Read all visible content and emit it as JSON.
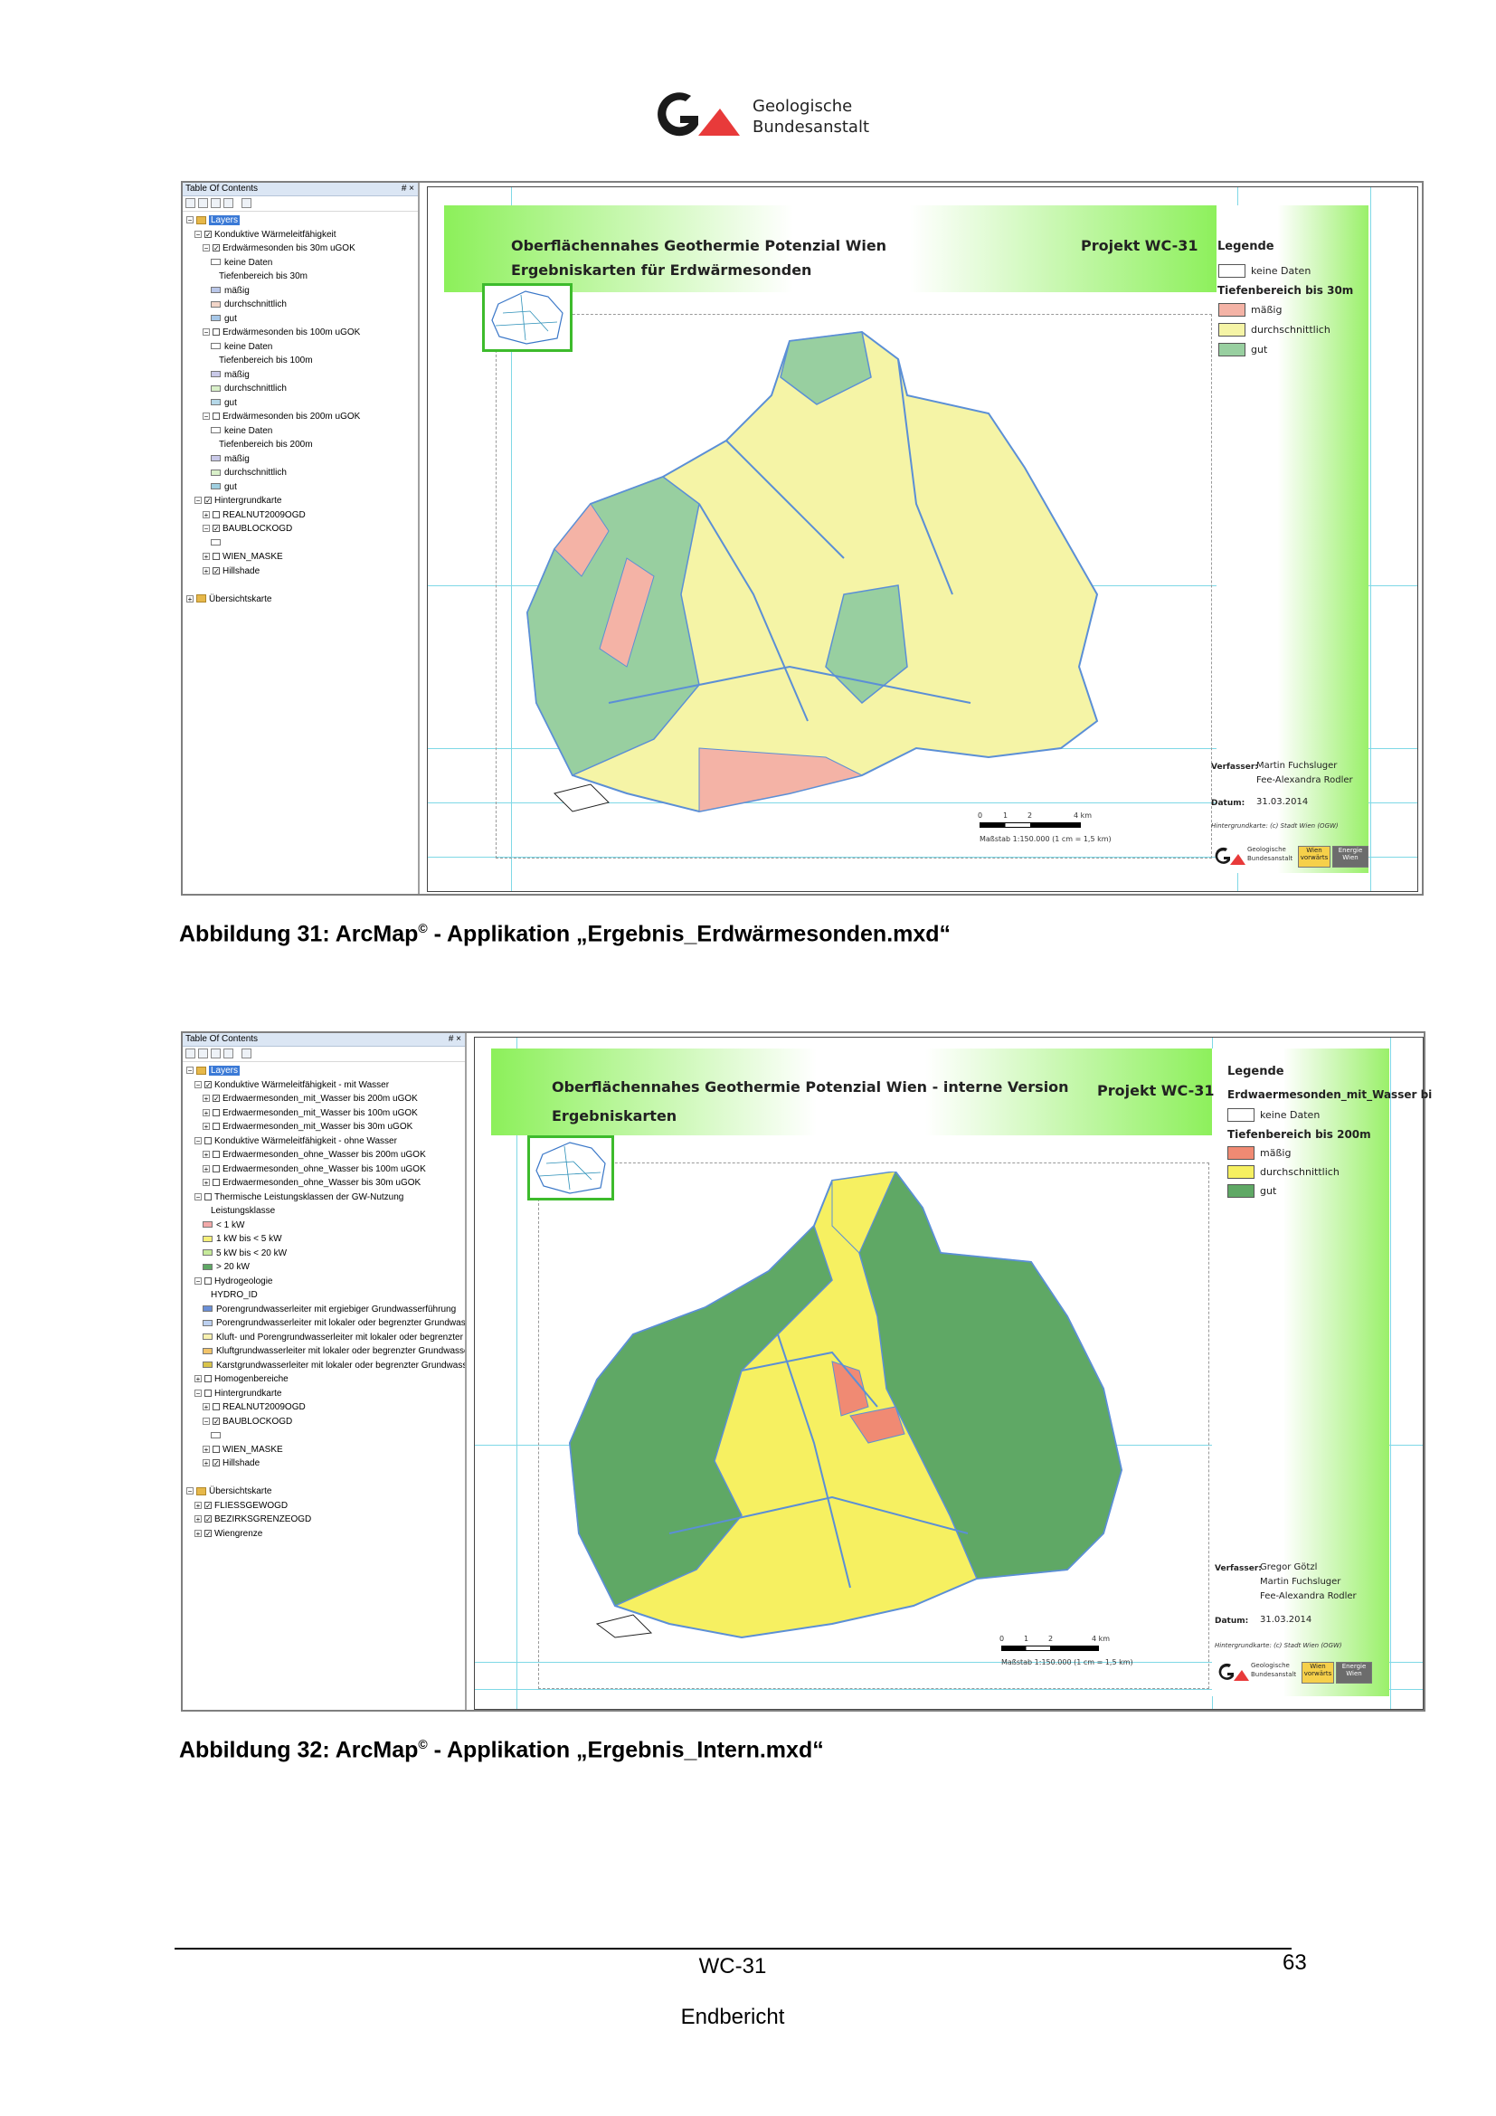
{
  "header": {
    "logo_line1": "Geologische",
    "logo_line2": "Bundesanstalt"
  },
  "colors": {
    "accent_red": "#e83a3a",
    "logo_dark": "#1a1a1a",
    "maessig": "#f4b3a6",
    "durchschnittlich": "#f5f4a6",
    "gut": "#98cfa0",
    "maessig_strong": "#f08a73",
    "durchschnittlich_strong": "#f6f061",
    "gut_strong": "#5fa865",
    "banner_green": "#8cf05a"
  },
  "figure1": {
    "toc": {
      "title": "Table Of Contents",
      "pin": "# ×",
      "rows": [
        {
          "indent": 0,
          "exp": "−",
          "grp": true,
          "text": "Layers",
          "selected": true
        },
        {
          "indent": 1,
          "exp": "−",
          "cb": "✓",
          "text": "Konduktive Wärmeleitfähigkeit"
        },
        {
          "indent": 2,
          "exp": "−",
          "cb": "✓",
          "text": "Erdwärmesonden bis 30m uGOK"
        },
        {
          "indent": 3,
          "sw": "#ffffff",
          "text": "keine Daten"
        },
        {
          "indent": 4,
          "text": "Tiefenbereich bis 30m"
        },
        {
          "indent": 3,
          "sw": "#b9c6e8",
          "text": "mäßig"
        },
        {
          "indent": 3,
          "sw": "#f2d5c8",
          "text": "durchschnittlich"
        },
        {
          "indent": 3,
          "sw": "#a6c7e8",
          "text": "gut"
        },
        {
          "indent": 2,
          "exp": "−",
          "cb": "",
          "text": "Erdwärmesonden bis 100m uGOK"
        },
        {
          "indent": 3,
          "sw": "#ffffff",
          "text": "keine Daten"
        },
        {
          "indent": 4,
          "text": "Tiefenbereich bis 100m"
        },
        {
          "indent": 3,
          "sw": "#c9c9e8",
          "text": "mäßig"
        },
        {
          "indent": 3,
          "sw": "#d9f0c9",
          "text": "durchschnittlich"
        },
        {
          "indent": 3,
          "sw": "#b5d8e8",
          "text": "gut"
        },
        {
          "indent": 2,
          "exp": "−",
          "cb": "",
          "text": "Erdwärmesonden bis 200m uGOK"
        },
        {
          "indent": 3,
          "sw": "#ffffff",
          "text": "keine Daten"
        },
        {
          "indent": 4,
          "text": "Tiefenbereich bis 200m"
        },
        {
          "indent": 3,
          "sw": "#c9c9e8",
          "text": "mäßig"
        },
        {
          "indent": 3,
          "sw": "#d9f0c9",
          "text": "durchschnittlich"
        },
        {
          "indent": 3,
          "sw": "#9fcfe0",
          "text": "gut"
        },
        {
          "indent": 1,
          "exp": "−",
          "cb": "✓",
          "text": "Hintergrundkarte"
        },
        {
          "indent": 2,
          "exp": "+",
          "cb": "",
          "text": "REALNUT2009OGD"
        },
        {
          "indent": 2,
          "exp": "−",
          "cb": "✓",
          "text": "BAUBLOCKOGD"
        },
        {
          "indent": 3,
          "sw": "#ffffff",
          "text": ""
        },
        {
          "indent": 2,
          "exp": "+",
          "cb": "",
          "text": "WIEN_MASKE"
        },
        {
          "indent": 2,
          "exp": "+",
          "cb": "✓",
          "text": "Hillshade"
        },
        {
          "indent": 0,
          "text": ""
        },
        {
          "indent": 0,
          "exp": "+",
          "grp": true,
          "text": "Übersichtskarte"
        }
      ]
    },
    "map": {
      "title1": "Oberflächennahes Geothermie Potenzial Wien",
      "title2": "Ergebniskarten für Erdwärmesonden",
      "project": "Projekt WC-31",
      "legend_title": "Legende",
      "legend_nodata": "keine Daten",
      "legend_depth": "Tiefenbereich bis 30m",
      "legend_items": [
        "mäßig",
        "durchschnittlich",
        "gut"
      ],
      "author_label": "Verfasser:",
      "authors": [
        "Martin Fuchsluger",
        "Fee-Alexandra Rodler"
      ],
      "date_label": "Datum:",
      "date": "31.03.2014",
      "background_note": "Hintergrundkarte: (c) Stadt Wien (OGW)",
      "scale_ticks": [
        "0",
        "1",
        "2",
        "4 km"
      ],
      "scale_text": "Maßstab 1:150.000 (1 cm = 1,5 km)",
      "gba_line1": "Geologische",
      "gba_line2": "Bundesanstalt",
      "partner1": "Wien vorwärts",
      "partner2": "Energie Wien"
    },
    "caption_prefix": "Abbildung 31:",
    "caption_app": "ArcMap",
    "caption_sup": "©",
    "caption_rest": " - Applikation „Ergebnis_Erdwärmesonden.mxd“"
  },
  "figure2": {
    "toc": {
      "title": "Table Of Contents",
      "pin": "# ×",
      "rows": [
        {
          "indent": 0,
          "exp": "−",
          "grp": true,
          "text": "Layers",
          "selected": true
        },
        {
          "indent": 1,
          "exp": "−",
          "cb": "✓",
          "text": "Konduktive Wärmeleitfähigkeit - mit  Wasser"
        },
        {
          "indent": 2,
          "exp": "+",
          "cb": "✓",
          "text": "Erdwaermesonden_mit_Wasser bis 200m uGOK"
        },
        {
          "indent": 2,
          "exp": "+",
          "cb": "",
          "text": "Erdwaermesonden_mit_Wasser bis 100m uGOK"
        },
        {
          "indent": 2,
          "exp": "+",
          "cb": "",
          "text": "Erdwaermesonden_mit_Wasser bis 30m uGOK"
        },
        {
          "indent": 1,
          "exp": "−",
          "cb": "",
          "text": "Konduktive Wärmeleitfähigkeit - ohne Wasser"
        },
        {
          "indent": 2,
          "exp": "+",
          "cb": "",
          "text": "Erdwaermesonden_ohne_Wasser bis 200m uGOK"
        },
        {
          "indent": 2,
          "exp": "+",
          "cb": "",
          "text": "Erdwaermesonden_ohne_Wasser bis 100m uGOK"
        },
        {
          "indent": 2,
          "exp": "+",
          "cb": "",
          "text": "Erdwaermesonden_ohne_Wasser bis 30m uGOK"
        },
        {
          "indent": 1,
          "exp": "−",
          "cb": "",
          "text": "Thermische Leistungsklassen der GW-Nutzung"
        },
        {
          "indent": 3,
          "text": "Leistungsklasse"
        },
        {
          "indent": 2,
          "sw": "#f2a9a9",
          "text": "< 1 kW"
        },
        {
          "indent": 2,
          "sw": "#f6f07a",
          "text": "1 kW bis < 5 kW"
        },
        {
          "indent": 2,
          "sw": "#c6ea9a",
          "text": "5 kW bis < 20 kW"
        },
        {
          "indent": 2,
          "sw": "#5fa865",
          "text": "> 20 kW"
        },
        {
          "indent": 1,
          "exp": "−",
          "cb": "",
          "text": "Hydrogeologie"
        },
        {
          "indent": 3,
          "text": "HYDRO_ID"
        },
        {
          "indent": 2,
          "sw": "#6a8fd6",
          "text": "Porengrundwasserleiter mit ergiebiger Grundwasserführung"
        },
        {
          "indent": 2,
          "sw": "#bcd0f0",
          "text": "Porengrundwasserleiter mit lokaler oder begrenzter Grundwasserführung"
        },
        {
          "indent": 2,
          "sw": "#f8f1b0",
          "text": "Kluft- und Porengrundwasserleiter mit lokaler oder begrenzter Grundwasserführung"
        },
        {
          "indent": 2,
          "sw": "#f2c46a",
          "text": "Kluftgrundwasserleiter mit lokaler oder begrenzter Grundwasserführung"
        },
        {
          "indent": 2,
          "sw": "#d9c44a",
          "text": "Karstgrundwasserleiter mit lokaler oder begrenzter Grundwasserführung"
        },
        {
          "indent": 1,
          "exp": "+",
          "cb": "",
          "text": "Homogenbereiche"
        },
        {
          "indent": 1,
          "exp": "−",
          "cb": "",
          "text": "Hintergrundkarte"
        },
        {
          "indent": 2,
          "exp": "+",
          "cb": "",
          "text": "REALNUT2009OGD"
        },
        {
          "indent": 2,
          "exp": "−",
          "cb": "✓",
          "text": "BAUBLOCKOGD"
        },
        {
          "indent": 3,
          "sw": "#ffffff",
          "text": ""
        },
        {
          "indent": 2,
          "exp": "+",
          "cb": "",
          "text": "WIEN_MASKE"
        },
        {
          "indent": 2,
          "exp": "+",
          "cb": "✓",
          "text": "Hillshade"
        },
        {
          "indent": 0,
          "text": ""
        },
        {
          "indent": 0,
          "exp": "−",
          "grp": true,
          "text": "Übersichtskarte"
        },
        {
          "indent": 1,
          "exp": "+",
          "cb": "✓",
          "text": "FLIESSGEWOGD"
        },
        {
          "indent": 1,
          "exp": "+",
          "cb": "✓",
          "text": "BEZIRKSGRENZEOGD"
        },
        {
          "indent": 1,
          "exp": "+",
          "cb": "✓",
          "text": "Wiengrenze"
        }
      ]
    },
    "map": {
      "title1": "Oberflächennahes Geothermie Potenzial Wien - interne Version",
      "title2": "Ergebniskarten",
      "project": "Projekt WC-31",
      "legend_title": "Legende",
      "legend_layer": "Erdwaermesonden_mit_Wasser bi",
      "legend_nodata": "keine Daten",
      "legend_depth": "Tiefenbereich bis 200m",
      "legend_items": [
        "mäßig",
        "durchschnittlich",
        "gut"
      ],
      "author_label": "Verfasser:",
      "authors": [
        "Gregor Götzl",
        "Martin Fuchsluger",
        "Fee-Alexandra Rodler"
      ],
      "date_label": "Datum:",
      "date": "31.03.2014",
      "background_note": "Hintergrundkarte: (c) Stadt Wien (OGW)",
      "scale_ticks": [
        "0",
        "1",
        "2",
        "4 km"
      ],
      "scale_text": "Maßstab 1:150.000 (1 cm = 1,5 km)",
      "gba_line1": "Geologische",
      "gba_line2": "Bundesanstalt",
      "partner1": "Wien vorwärts",
      "partner2": "Energie Wien"
    },
    "caption_prefix": "Abbildung 32:",
    "caption_app": "ArcMap",
    "caption_sup": "©",
    "caption_rest": " - Applikation „Ergebnis_Intern.mxd“"
  },
  "footer": {
    "code": "WC-31",
    "page": "63",
    "doc": "Endbericht"
  }
}
